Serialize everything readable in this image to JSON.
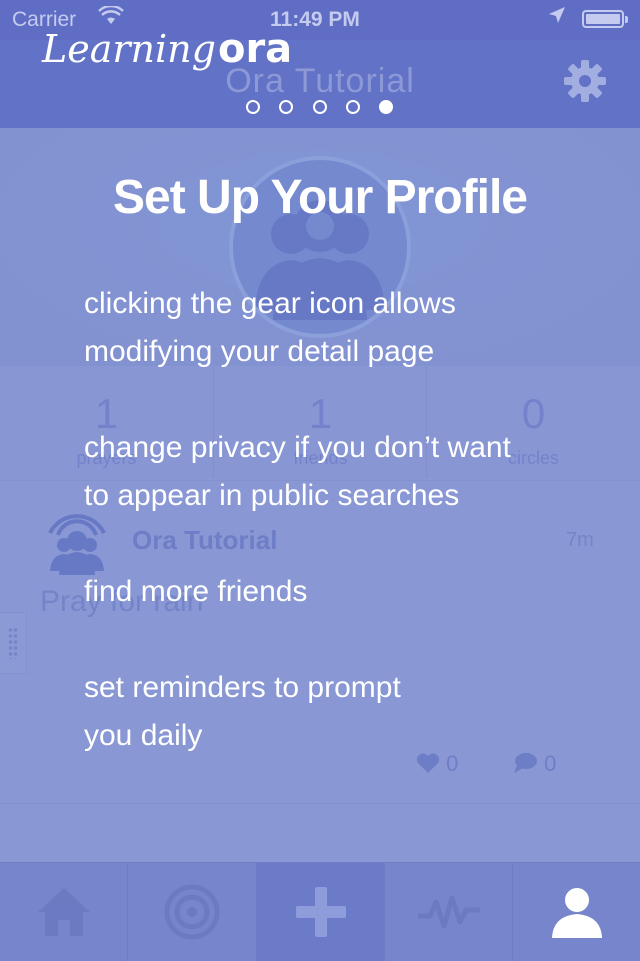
{
  "status_bar": {
    "carrier": "Carrier",
    "time": "11:49 PM"
  },
  "nav": {
    "title": "Ora Tutorial",
    "settings_icon": "gear-icon"
  },
  "profile": {
    "stats": [
      {
        "value": "1",
        "label": "prayers"
      },
      {
        "value": "1",
        "label": "friends"
      },
      {
        "value": "0",
        "label": "circles"
      }
    ]
  },
  "feed": {
    "post": {
      "author": "Ora Tutorial",
      "time": "7m",
      "text": "Pray for rain",
      "likes": "0",
      "comments": "0"
    }
  },
  "tabbar": {
    "tabs": [
      {
        "name": "home",
        "icon": "home-icon"
      },
      {
        "name": "circles",
        "icon": "target-icon"
      },
      {
        "name": "add",
        "icon": "plus-icon",
        "active": false
      },
      {
        "name": "activity",
        "icon": "pulse-icon"
      },
      {
        "name": "profile",
        "icon": "person-icon",
        "active": true
      }
    ]
  },
  "tutorial": {
    "brand_learning": "Learning",
    "brand_ora": "ora",
    "page_count": 5,
    "current_page": 5,
    "title": "Set Up Your Profile",
    "tips": [
      {
        "line1": "clicking the gear icon allows",
        "line2": "modifying your detail page"
      },
      {
        "line1": "change privacy if you don’t want",
        "line2": "to appear in public searches"
      },
      {
        "line1": "find more friends",
        "line2": ""
      },
      {
        "line1": "set reminders to prompt",
        "line2": "you daily"
      }
    ]
  },
  "colors": {
    "overlay": "#7f8ed0",
    "nav": "#6272c6",
    "text": "#ffffff"
  }
}
